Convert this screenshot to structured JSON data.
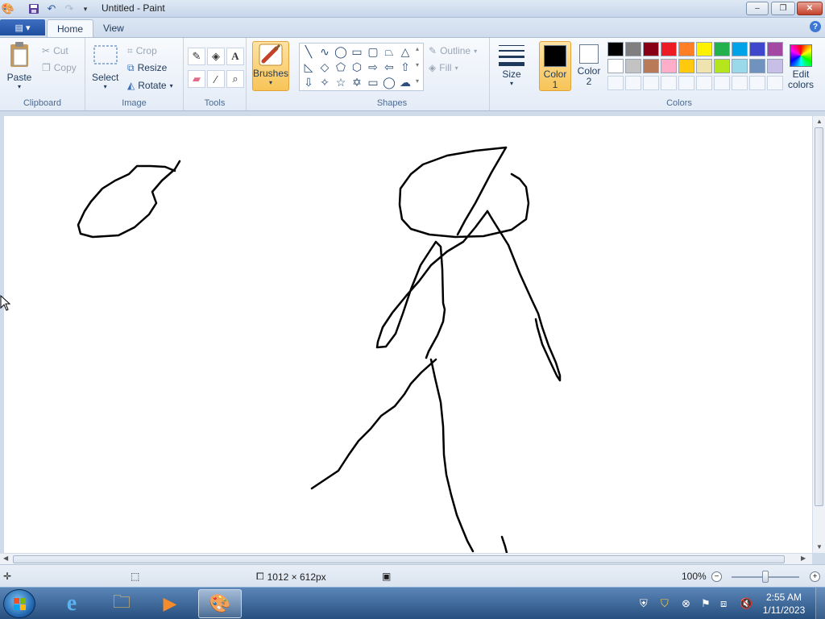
{
  "window": {
    "title": "Untitled - Paint",
    "minimize": "–",
    "maximize": "❐",
    "close": "✕"
  },
  "tabs": {
    "file": "▤ ▾",
    "home": "Home",
    "view": "View"
  },
  "ribbon": {
    "clipboard": {
      "label": "Clipboard",
      "paste": "Paste",
      "cut": "Cut",
      "copy": "Copy"
    },
    "image": {
      "label": "Image",
      "select": "Select",
      "crop": "Crop",
      "resize": "Resize",
      "rotate": "Rotate"
    },
    "tools": {
      "label": "Tools"
    },
    "brushes": {
      "label": "Brushes"
    },
    "shapes": {
      "label": "Shapes",
      "outline": "Outline",
      "fill": "Fill"
    },
    "size": {
      "label": "Size"
    },
    "colors": {
      "label": "Colors",
      "color1_label": "Color",
      "color1_num": "1",
      "color2_label": "Color",
      "color2_num": "2",
      "edit_label": "Edit",
      "edit_label2": "colors",
      "color1_value": "#000000",
      "color2_value": "#ffffff",
      "palette_row1": [
        "#000000",
        "#7f7f7f",
        "#880015",
        "#ed1c24",
        "#ff7f27",
        "#fff200",
        "#22b14c",
        "#00a2e8",
        "#3f48cc",
        "#a349a4"
      ],
      "palette_row2": [
        "#ffffff",
        "#c3c3c3",
        "#b97a57",
        "#ffaec9",
        "#ffc90e",
        "#efe4b0",
        "#b5e61d",
        "#99d9ea",
        "#7092be",
        "#c8bfe7"
      ]
    }
  },
  "status": {
    "canvas_size": "1012 × 612px",
    "zoom": "100%"
  },
  "taskbar": {
    "time": "2:55 AM",
    "date": "1/11/2023"
  }
}
